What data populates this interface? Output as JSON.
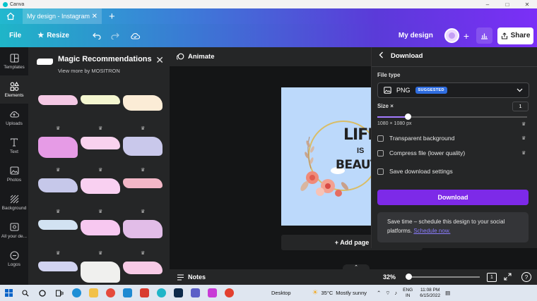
{
  "window": {
    "title": "Canva",
    "controls": [
      "–",
      "□",
      "✕"
    ]
  },
  "browser": {
    "tab_title": "My design - Instagram ...",
    "tab_close": "✕",
    "new_tab": "+"
  },
  "toolbar": {
    "file": "File",
    "resize": "Resize",
    "design_name": "My design",
    "share": "Share",
    "plus": "+"
  },
  "rail": {
    "items": [
      {
        "label": "Templates",
        "icon": "templates-icon"
      },
      {
        "label": "Elements",
        "icon": "elements-icon"
      },
      {
        "label": "Uploads",
        "icon": "uploads-icon"
      },
      {
        "label": "Text",
        "icon": "text-icon"
      },
      {
        "label": "Photos",
        "icon": "photos-icon"
      },
      {
        "label": "Background",
        "icon": "background-icon"
      },
      {
        "label": "All your de...",
        "icon": "folder-icon"
      },
      {
        "label": "Logos",
        "icon": "logos-icon"
      }
    ]
  },
  "panel": {
    "title": "Magic Recommendations",
    "subtitle": "View more by MOSITRON",
    "close": "✕",
    "crown": "♛",
    "swatch_rows": [
      [
        "#f4c8e4",
        "#f4f6d0",
        "#fbecd6"
      ],
      [
        "#e69be6",
        "#f9d2ee",
        "#c9c8eb"
      ],
      [
        "#c6c8ea",
        "#f9d0f1",
        "#f3b7c7"
      ],
      [
        "#d2e2f2",
        "#f7c8f0",
        "#e2bde8"
      ],
      [
        "#d1d3f0",
        "#f0f0ee",
        "#f7cae6"
      ]
    ]
  },
  "canvas": {
    "animate": "Animate",
    "design_words": [
      "LIFE",
      "IS",
      "BEAUTIF"
    ],
    "add_page": "+ Add page",
    "background": "#bcd9fb"
  },
  "bottombar": {
    "notes": "Notes",
    "zoom": "32%",
    "page": "1",
    "help": "?"
  },
  "download": {
    "title": "Download",
    "file_type_label": "File type",
    "file_type": "PNG",
    "badge": "SUGGESTED",
    "size_label": "Size ×",
    "size_value": "1",
    "dims": "1080 × 1080 px",
    "options": [
      "Transparent background",
      "Compress file (lower quality)",
      "Save download settings"
    ],
    "button": "Download",
    "promo_text": "Save time – schedule this design to your social platforms. ",
    "promo_link": "Schedule now.",
    "accent": "#7d2ae8"
  },
  "taskbar": {
    "desktop": "Desktop",
    "temp": "35°C",
    "weather": "Mostly sunny",
    "lang1": "ENG",
    "lang2": "IN",
    "time": "11:08 PM",
    "date": "6/15/2022"
  }
}
